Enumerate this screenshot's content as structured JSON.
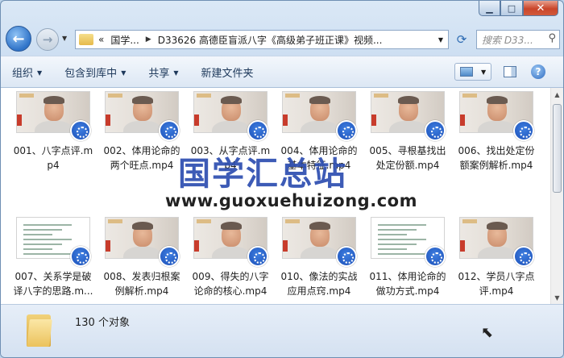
{
  "window": {
    "controls": {
      "minimize": "▁",
      "maximize": "□",
      "close": "✕"
    }
  },
  "address": {
    "overflow": "«",
    "segments": [
      "国学...",
      "D33626 高德臣盲派八字《高级弟子班正课》视频..."
    ],
    "search_placeholder": "搜索 D33..."
  },
  "toolbar": {
    "organize": "组织",
    "include_in_library": "包含到库中",
    "share": "共享",
    "new_folder": "新建文件夹"
  },
  "files": [
    {
      "name": "001、八字点评.mp4",
      "kind": "video"
    },
    {
      "name": "002、体用论命的两个旺点.mp4",
      "kind": "video"
    },
    {
      "name": "003、从字点评.mp4",
      "kind": "video"
    },
    {
      "name": "004、体用论命的基本特征.mp4",
      "kind": "video"
    },
    {
      "name": "005、寻根基找出处定份额.mp4",
      "kind": "video"
    },
    {
      "name": "006、找出处定份额案例解析.mp4",
      "kind": "video"
    },
    {
      "name": "007、关系学是破译八字的思路.m...",
      "kind": "doc"
    },
    {
      "name": "008、发表归根案例解析.mp4",
      "kind": "video"
    },
    {
      "name": "009、得失的八字论命的核心.mp4",
      "kind": "video"
    },
    {
      "name": "010、像法的实战应用点窍.mp4",
      "kind": "video"
    },
    {
      "name": "011、体用论命的做功方式.mp4",
      "kind": "doc"
    },
    {
      "name": "012、学员八字点评.mp4",
      "kind": "video"
    }
  ],
  "status": {
    "count": "130 个对象"
  },
  "watermark": {
    "title": "国学汇总站",
    "url": "www.guoxuehuizong.com"
  },
  "colors": {
    "accent": "#2f73c8",
    "watermark": "#2d4eb0"
  }
}
